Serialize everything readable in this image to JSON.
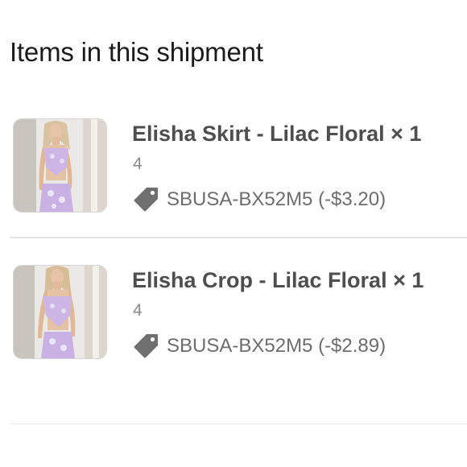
{
  "section": {
    "title": "Items in this shipment"
  },
  "items": [
    {
      "name": "Elisha Skirt - Lilac Floral × 1",
      "quantity": "4",
      "discount": "SBUSA-BX52M5 (-$3.20)",
      "image_alt": "Elisha Skirt - Lilac Floral"
    },
    {
      "name": "Elisha Crop - Lilac Floral × 1",
      "quantity": "4",
      "discount": "SBUSA-BX52M5 (-$2.89)",
      "image_alt": "Elisha Crop - Lilac Floral"
    }
  ],
  "icons": {
    "discount": "tag-icon"
  },
  "colors": {
    "item_name": "#4e4e4e",
    "tag_icon": "#6f6f6f",
    "divider": "#e4e4e4",
    "garment": "#cdb6e6"
  }
}
